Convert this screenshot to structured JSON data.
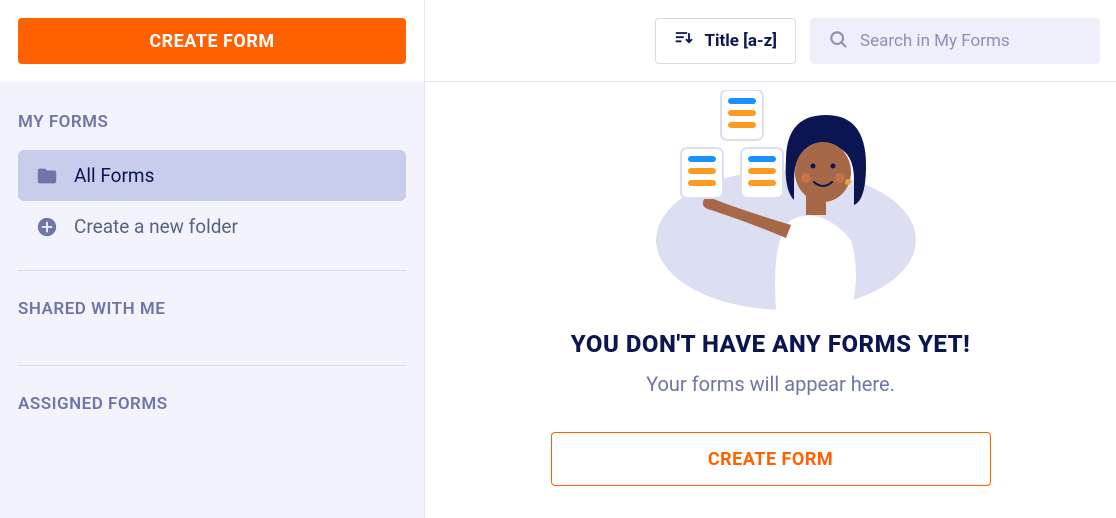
{
  "sidebar": {
    "create_button": "CREATE FORM",
    "section_my_forms": "MY FORMS",
    "all_forms": "All Forms",
    "create_folder": "Create a new folder",
    "section_shared": "SHARED WITH ME",
    "section_assigned": "ASSIGNED FORMS"
  },
  "topbar": {
    "sort_label": "Title [a-z]",
    "search_placeholder": "Search in My Forms"
  },
  "empty": {
    "title": "YOU DON'T HAVE ANY FORMS YET!",
    "subtitle": "Your forms will appear here.",
    "cta": "CREATE FORM"
  }
}
